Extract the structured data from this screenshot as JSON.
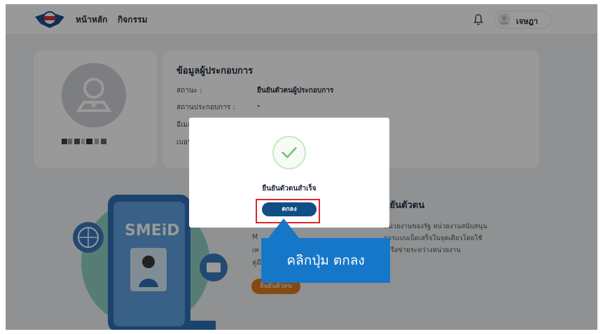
{
  "header": {
    "nav_home": "หน้าหลัก",
    "nav_activity": "กิจกรรม",
    "user_name": "เจษฎา"
  },
  "profile": {
    "info_title": "ข้อมูลผู้ประกอบการ",
    "rows": [
      {
        "label": "สถานะ :",
        "value": "ยืนยันตัวตนผู้ประกอบการ"
      },
      {
        "label": "สถานประกอบการ :",
        "value": "-"
      },
      {
        "label": "อีเมล",
        "value": ""
      },
      {
        "label": "เบอร์",
        "value": ""
      }
    ]
  },
  "banner": {
    "title": "ยืนยันตัวตน",
    "lines": [
      "หน่วยงานของรัฐ หน่วยงานสนับสนุน",
      "การแบบเบ็ดเสร็จในจุดเดียวโดยใช้",
      "เครือข่ายระหว่างหน่วยงาน"
    ],
    "line_prefixes": [
      "M",
      "เท",
      "คู่มื"
    ],
    "button_label": "ยืนยันตัวตน",
    "illustration_text": "SMEiD"
  },
  "modal": {
    "message": "ยืนยันตัวตนสำเร็จ",
    "ok_label": "ตกลง"
  },
  "callout": {
    "text": "คลิกปุ่ม ตกลง"
  },
  "colors": {
    "primary": "#124e86",
    "callout": "#1677c9",
    "highlight": "#e0242c",
    "accent_orange": "#e07b1a",
    "success": "#7cc47a"
  }
}
